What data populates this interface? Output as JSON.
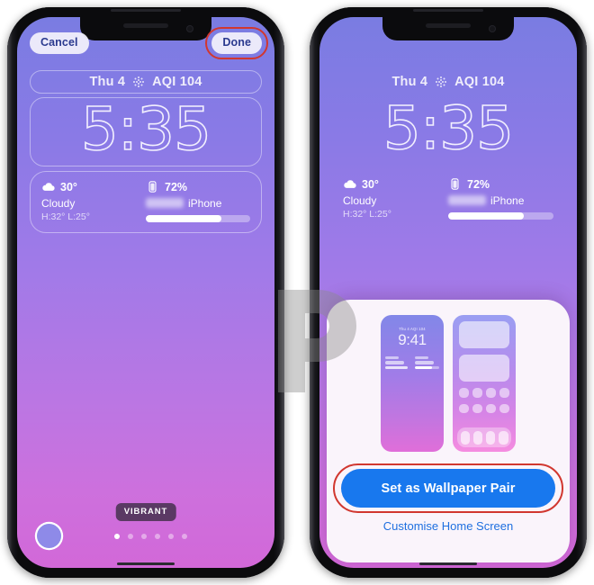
{
  "screen_title": "iOS Lock Screen wallpaper editor",
  "left_phone": {
    "mode": "edit",
    "topbar": {
      "cancel_label": "Cancel",
      "done_label": "Done",
      "done_highlighted": true,
      "highlight_color": "#d1372f"
    },
    "lock": {
      "top_widget": {
        "date": "Thu 4",
        "aqi_icon": "aqi-dots-icon",
        "aqi": "AQI 104"
      },
      "time": "5:35",
      "weather_widget": {
        "icon": "cloud-icon",
        "temperature": "30°",
        "condition": "Cloudy",
        "high_low": "H:32° L:25°"
      },
      "battery_widget": {
        "icon": "battery-icon",
        "percent": "72%",
        "device": "iPhone",
        "device_name_blurred": true,
        "fill_percent": 72
      }
    },
    "style_badge": "VIBRANT",
    "color_swatch": "#8e8ae8",
    "page_dots": {
      "count": 6,
      "active_index": 0
    }
  },
  "right_phone": {
    "mode": "preview",
    "lock": {
      "top_widget": {
        "date": "Thu 4",
        "aqi_icon": "aqi-dots-icon",
        "aqi": "AQI 104"
      },
      "time": "5:35",
      "weather_widget": {
        "icon": "cloud-icon",
        "temperature": "30°",
        "condition": "Cloudy",
        "high_low": "H:32° L:25°"
      },
      "battery_widget": {
        "icon": "battery-icon",
        "percent": "72%",
        "device": "iPhone",
        "device_name_blurred": true,
        "fill_percent": 72
      }
    },
    "sheet": {
      "lock_preview": {
        "date": "Thu 4  AQI 104",
        "time": "9:41"
      },
      "home_preview": {
        "widgets": 2,
        "icon_rows": 2,
        "icons_per_row": 4,
        "dock_icons": 4
      },
      "primary_button": "Set as Wallpaper Pair",
      "primary_button_color": "#1878ee",
      "primary_button_highlighted": true,
      "highlight_color": "#d1372f",
      "secondary_link": "Customise Home Screen",
      "secondary_link_color": "#1f6fe0"
    }
  },
  "watermark": {
    "shape": "rounded-p-logo",
    "color": "#9a9a9a"
  }
}
